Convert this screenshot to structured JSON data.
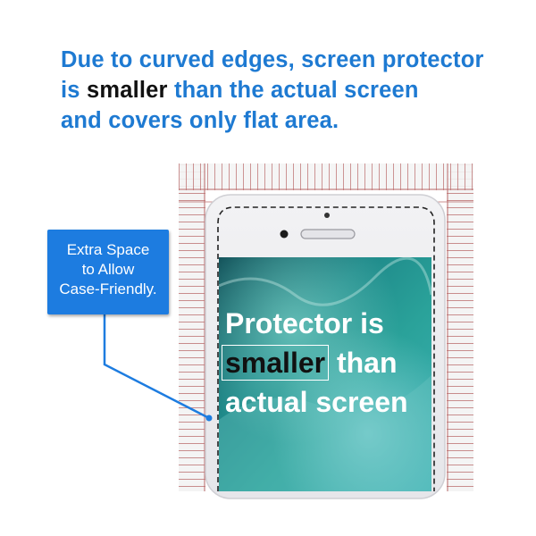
{
  "headline": {
    "line1": "Due to curved edges, screen protector",
    "line2_prefix": "is ",
    "line2_emphasis": "smaller",
    "line2_suffix": " than the actual screen",
    "line3": "and covers only flat area."
  },
  "callout": {
    "line1": "Extra Space",
    "line2": "to Allow",
    "line3": "Case-Friendly."
  },
  "screen_text": {
    "line1": "Protector is",
    "boxed_word": "smaller",
    "after_boxed": " than",
    "line3": "actual screen"
  },
  "colors": {
    "accent_blue": "#1e7ad2",
    "callout_blue": "#1d7ce0",
    "ruler_red": "#b35a5a"
  },
  "icons": [
    "phone-camera-icon",
    "phone-earpiece-icon",
    "ruler-graphic"
  ]
}
